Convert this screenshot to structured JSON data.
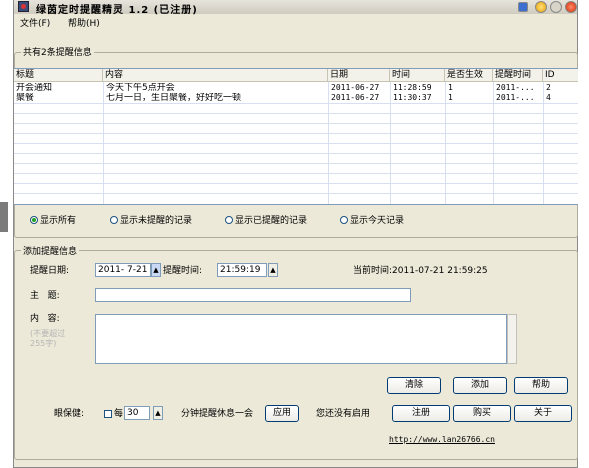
{
  "window": {
    "title": "绿茵定时提醒精灵 1.2 (已注册)",
    "menu": [
      "文件(F)",
      "帮助(H)"
    ]
  },
  "reminders_group": {
    "title": "共有2条提醒信息",
    "columns": [
      "标题",
      "内容",
      "日期",
      "时间",
      "是否生效",
      "提醒时间",
      "ID"
    ],
    "rows": [
      [
        "开会通知",
        "今天下午5点开会",
        "2011-06-27",
        "11:28:59",
        "1",
        "2011-...",
        "2"
      ],
      [
        "聚餐",
        "七月一日，生日聚餐，好好吃一顿",
        "2011-06-27",
        "11:30:37",
        "1",
        "2011-...",
        "4"
      ]
    ]
  },
  "filters": {
    "options": [
      "显示所有",
      "显示未提醒的记录",
      "显示已提醒的记录",
      "显示今天记录"
    ],
    "selected": "显示所有"
  },
  "add_group": {
    "title": "添加提醒信息",
    "date_label": "提醒日期:",
    "date_value": "2011- 7-21",
    "time_label": "提醒时间:",
    "time_value": "21:59:19",
    "current_label": "当前时间:",
    "current_value": "2011-07-21 21:59:25",
    "subject_label": "主   题:",
    "subject_value": "",
    "content_label": "内   容:",
    "content_hint": "(不要超过255字)",
    "content_value": "",
    "buttons": {
      "clear": "清除",
      "add": "添加",
      "help": "帮助",
      "register": "注册",
      "buy": "购买",
      "about": "关于",
      "apply": "应用"
    },
    "eye_label": "眼保健:",
    "every_label": "每",
    "minutes_value": "30",
    "minutes_suffix": "分钟提醒休息一会",
    "eye_status": "您还没有启用",
    "eye_enabled": false,
    "link": "http://www.lan26766.cn"
  }
}
